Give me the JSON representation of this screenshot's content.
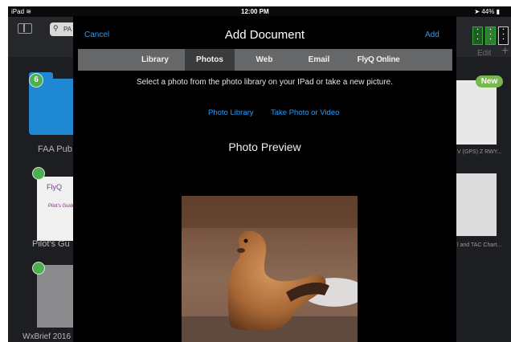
{
  "status_bar": {
    "device": "iPad",
    "time": "12:00 PM",
    "battery": "44%"
  },
  "background": {
    "search_text": "PA",
    "edit_label": "Edit",
    "badge_count": "6",
    "new_badge": "New",
    "tiles": [
      {
        "label": "FAA Pub"
      },
      {
        "label": "Pilot's Gu"
      },
      {
        "label": "WxBrief 2016"
      }
    ],
    "right_labels": [
      "V (GPS) Z RWY...",
      "l and TAC Chart..."
    ],
    "pilot_cover": {
      "brand": "FlyQ",
      "subtitle": "Pilot's Guide"
    }
  },
  "modal": {
    "cancel_label": "Cancel",
    "title": "Add Document",
    "add_label": "Add",
    "tabs": [
      {
        "label": "Library",
        "selected": false
      },
      {
        "label": "Photos",
        "selected": true
      },
      {
        "label": "Web",
        "selected": false
      },
      {
        "label": "Email",
        "selected": false
      },
      {
        "label": "FlyQ Online",
        "selected": false
      }
    ],
    "instruction": "Select a photo from the photo library on your IPad or take a new picture.",
    "photo_library_label": "Photo Library",
    "take_photo_label": "Take Photo or Video",
    "preview_title": "Photo Preview"
  },
  "colors": {
    "accent": "#2b9cf5",
    "modal_bg": "#000000",
    "tab_bar": "#666769",
    "tab_selected": "#3a3b3d"
  }
}
